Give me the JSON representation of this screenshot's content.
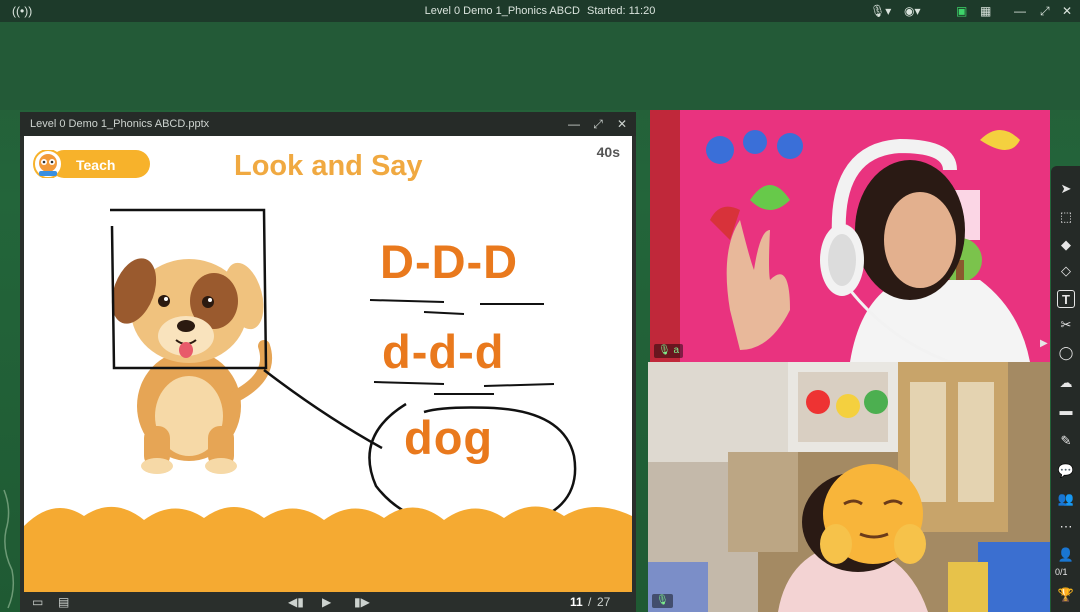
{
  "window": {
    "title": "Level 0 Demo 1_Phonics ABCD",
    "started": "Started: 11:20"
  },
  "slide_window": {
    "title": "Level 0 Demo 1_Phonics ABCD.pptx",
    "page_current": "11",
    "page_total": "27",
    "page_sep": "/"
  },
  "slide": {
    "badge": "Teach",
    "timer": "40s",
    "title": "Look and Say",
    "line1": "D-D-D",
    "line2": "d-d-d",
    "line3": "dog"
  },
  "toolbar": {
    "count": "0/1"
  },
  "video": {
    "teacher_label": "a",
    "student_label": ""
  },
  "icons": {
    "live": "broadcast-icon",
    "mic": "microphone-icon",
    "camera": "camera-icon",
    "record": "record-icon",
    "layout": "grid-icon",
    "minimize": "minimize-icon",
    "maximize": "maximize-icon",
    "close": "close-icon"
  },
  "colors": {
    "board": "#23653a",
    "title_orange": "#f0a941",
    "letters_orange": "#e9791d",
    "teacher_wall": "#e9337f"
  }
}
